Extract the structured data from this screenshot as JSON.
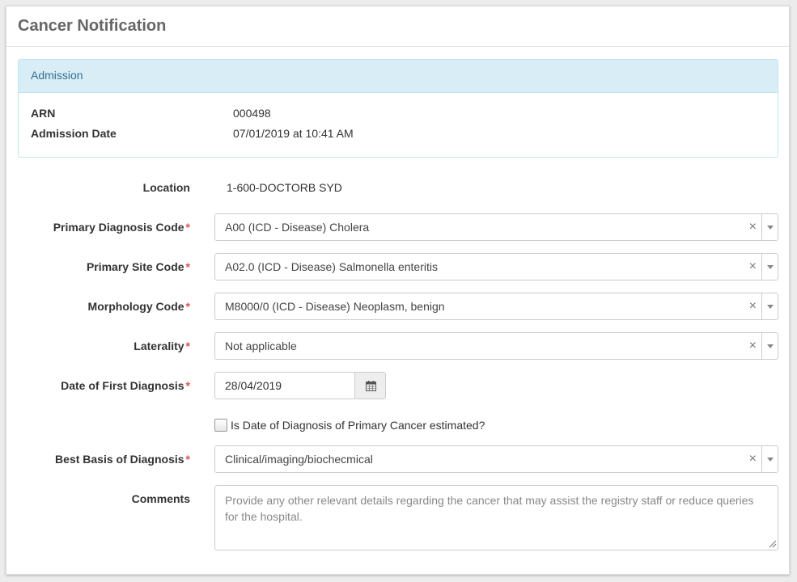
{
  "panel": {
    "title": "Cancer Notification"
  },
  "admission": {
    "heading": "Admission",
    "arn_label": "ARN",
    "arn_value": "000498",
    "date_label": "Admission Date",
    "date_value": "07/01/2019 at 10:41 AM"
  },
  "form": {
    "location": {
      "label": "Location",
      "value": "1-600-DOCTORB SYD"
    },
    "primary_diagnosis": {
      "label": "Primary Diagnosis Code",
      "value": "A00 (ICD - Disease) Cholera"
    },
    "primary_site": {
      "label": "Primary Site Code",
      "value": "A02.0 (ICD - Disease) Salmonella enteritis"
    },
    "morphology": {
      "label": "Morphology Code",
      "value": "M8000/0 (ICD - Disease) Neoplasm, benign"
    },
    "laterality": {
      "label": "Laterality",
      "value": "Not applicable"
    },
    "first_diagnosis_date": {
      "label": "Date of First Diagnosis",
      "value": "28/04/2019"
    },
    "estimated": {
      "label": "Is Date of Diagnosis of Primary Cancer estimated?",
      "checked": false
    },
    "best_basis": {
      "label": "Best Basis of Diagnosis",
      "value": "Clinical/imaging/biochecmical"
    },
    "comments": {
      "label": "Comments",
      "value": "",
      "placeholder": "Provide any other relevant details regarding the cancer that may assist the registry staff or reduce queries for the hospital."
    },
    "required_marker": "*",
    "clear_glyph": "×"
  },
  "icons": {
    "calendar": "calendar-icon",
    "clear": "clear-icon",
    "dropdown": "chevron-down-icon"
  },
  "colors": {
    "required": "#d9534f",
    "info_bg": "#d9edf7",
    "info_text": "#31708f"
  }
}
